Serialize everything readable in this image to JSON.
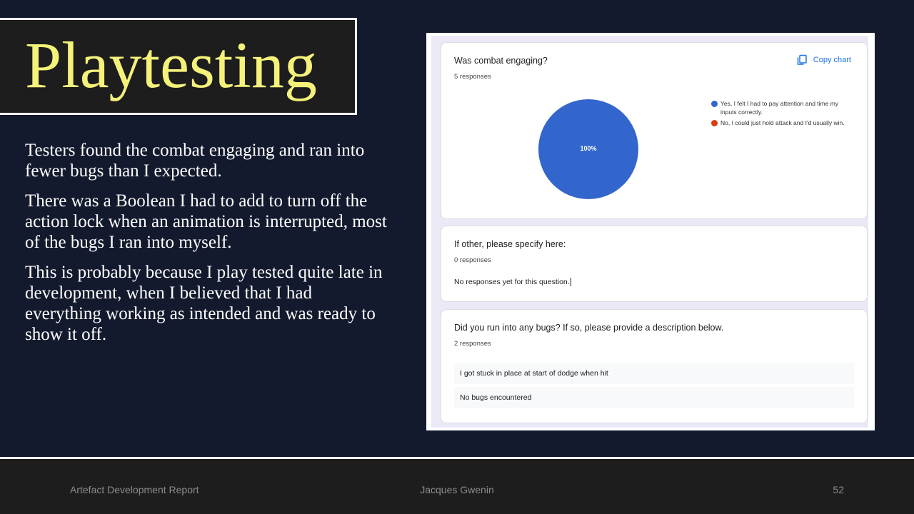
{
  "slide": {
    "title": "Playtesting",
    "paragraphs": [
      "Testers found the combat engaging and ran into fewer bugs than I expected.",
      "There was a Boolean I had to add to turn off the action lock when an animation is interrupted, most of the bugs I ran into myself.",
      "This is probably because I play tested quite late in development, when I believed that I had everything working as intended and was ready to show it off."
    ]
  },
  "form": {
    "q1": {
      "title": "Was combat engaging?",
      "responses": "5 responses",
      "copy_chart": "Copy chart",
      "legend": [
        {
          "label": "Yes, I felt I had to pay attention and time my inputs correctly.",
          "color": "#3366cc"
        },
        {
          "label": "No, I could just hold attack and I'd usually win.",
          "color": "#dc3912"
        }
      ]
    },
    "q2": {
      "title": "If other, please specify here:",
      "responses": "0 responses",
      "empty_text": "No responses yet for this question."
    },
    "q3": {
      "title": "Did you run into any bugs? If so, please provide a description below.",
      "responses": "2 responses",
      "answers": [
        "I got stuck in place at start of dodge when hit",
        "No bugs encountered"
      ]
    }
  },
  "chart_data": {
    "type": "pie",
    "categories": [
      "Yes, I felt I had to pay attention and time my inputs correctly.",
      "No, I could just hold attack and I'd usually win."
    ],
    "values": [
      100,
      0
    ],
    "slice_labels": [
      "100%"
    ],
    "colors": [
      "#3366cc",
      "#dc3912"
    ],
    "legend_position": "right"
  },
  "footer": {
    "left": "Artefact Development Report",
    "center": "Jacques Gwenin",
    "page": "52"
  }
}
